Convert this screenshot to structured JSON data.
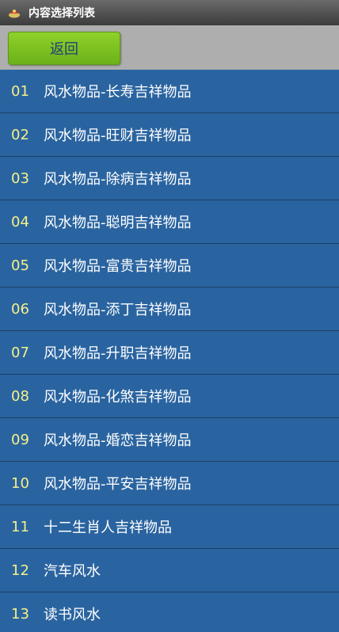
{
  "titlebar": {
    "icon": "app-logo-icon",
    "title": "内容选择列表"
  },
  "toolbar": {
    "back_label": "返回"
  },
  "colors": {
    "list_background": "#2a64a0",
    "number_color": "#f4f08a",
    "button_green": "#7ec424",
    "toolbar_gray": "#aeaeae"
  },
  "list": {
    "items": [
      {
        "num": "01",
        "label": "风水物品-长寿吉祥物品"
      },
      {
        "num": "02",
        "label": "风水物品-旺财吉祥物品"
      },
      {
        "num": "03",
        "label": "风水物品-除病吉祥物品"
      },
      {
        "num": "04",
        "label": "风水物品-聪明吉祥物品"
      },
      {
        "num": "05",
        "label": "风水物品-富贵吉祥物品"
      },
      {
        "num": "06",
        "label": "风水物品-添丁吉祥物品"
      },
      {
        "num": "07",
        "label": "风水物品-升职吉祥物品"
      },
      {
        "num": "08",
        "label": "风水物品-化煞吉祥物品"
      },
      {
        "num": "09",
        "label": "风水物品-婚恋吉祥物品"
      },
      {
        "num": "10",
        "label": "风水物品-平安吉祥物品"
      },
      {
        "num": "11",
        "label": "十二生肖人吉祥物品"
      },
      {
        "num": "12",
        "label": "汽车风水"
      },
      {
        "num": "13",
        "label": "读书风水"
      }
    ]
  }
}
